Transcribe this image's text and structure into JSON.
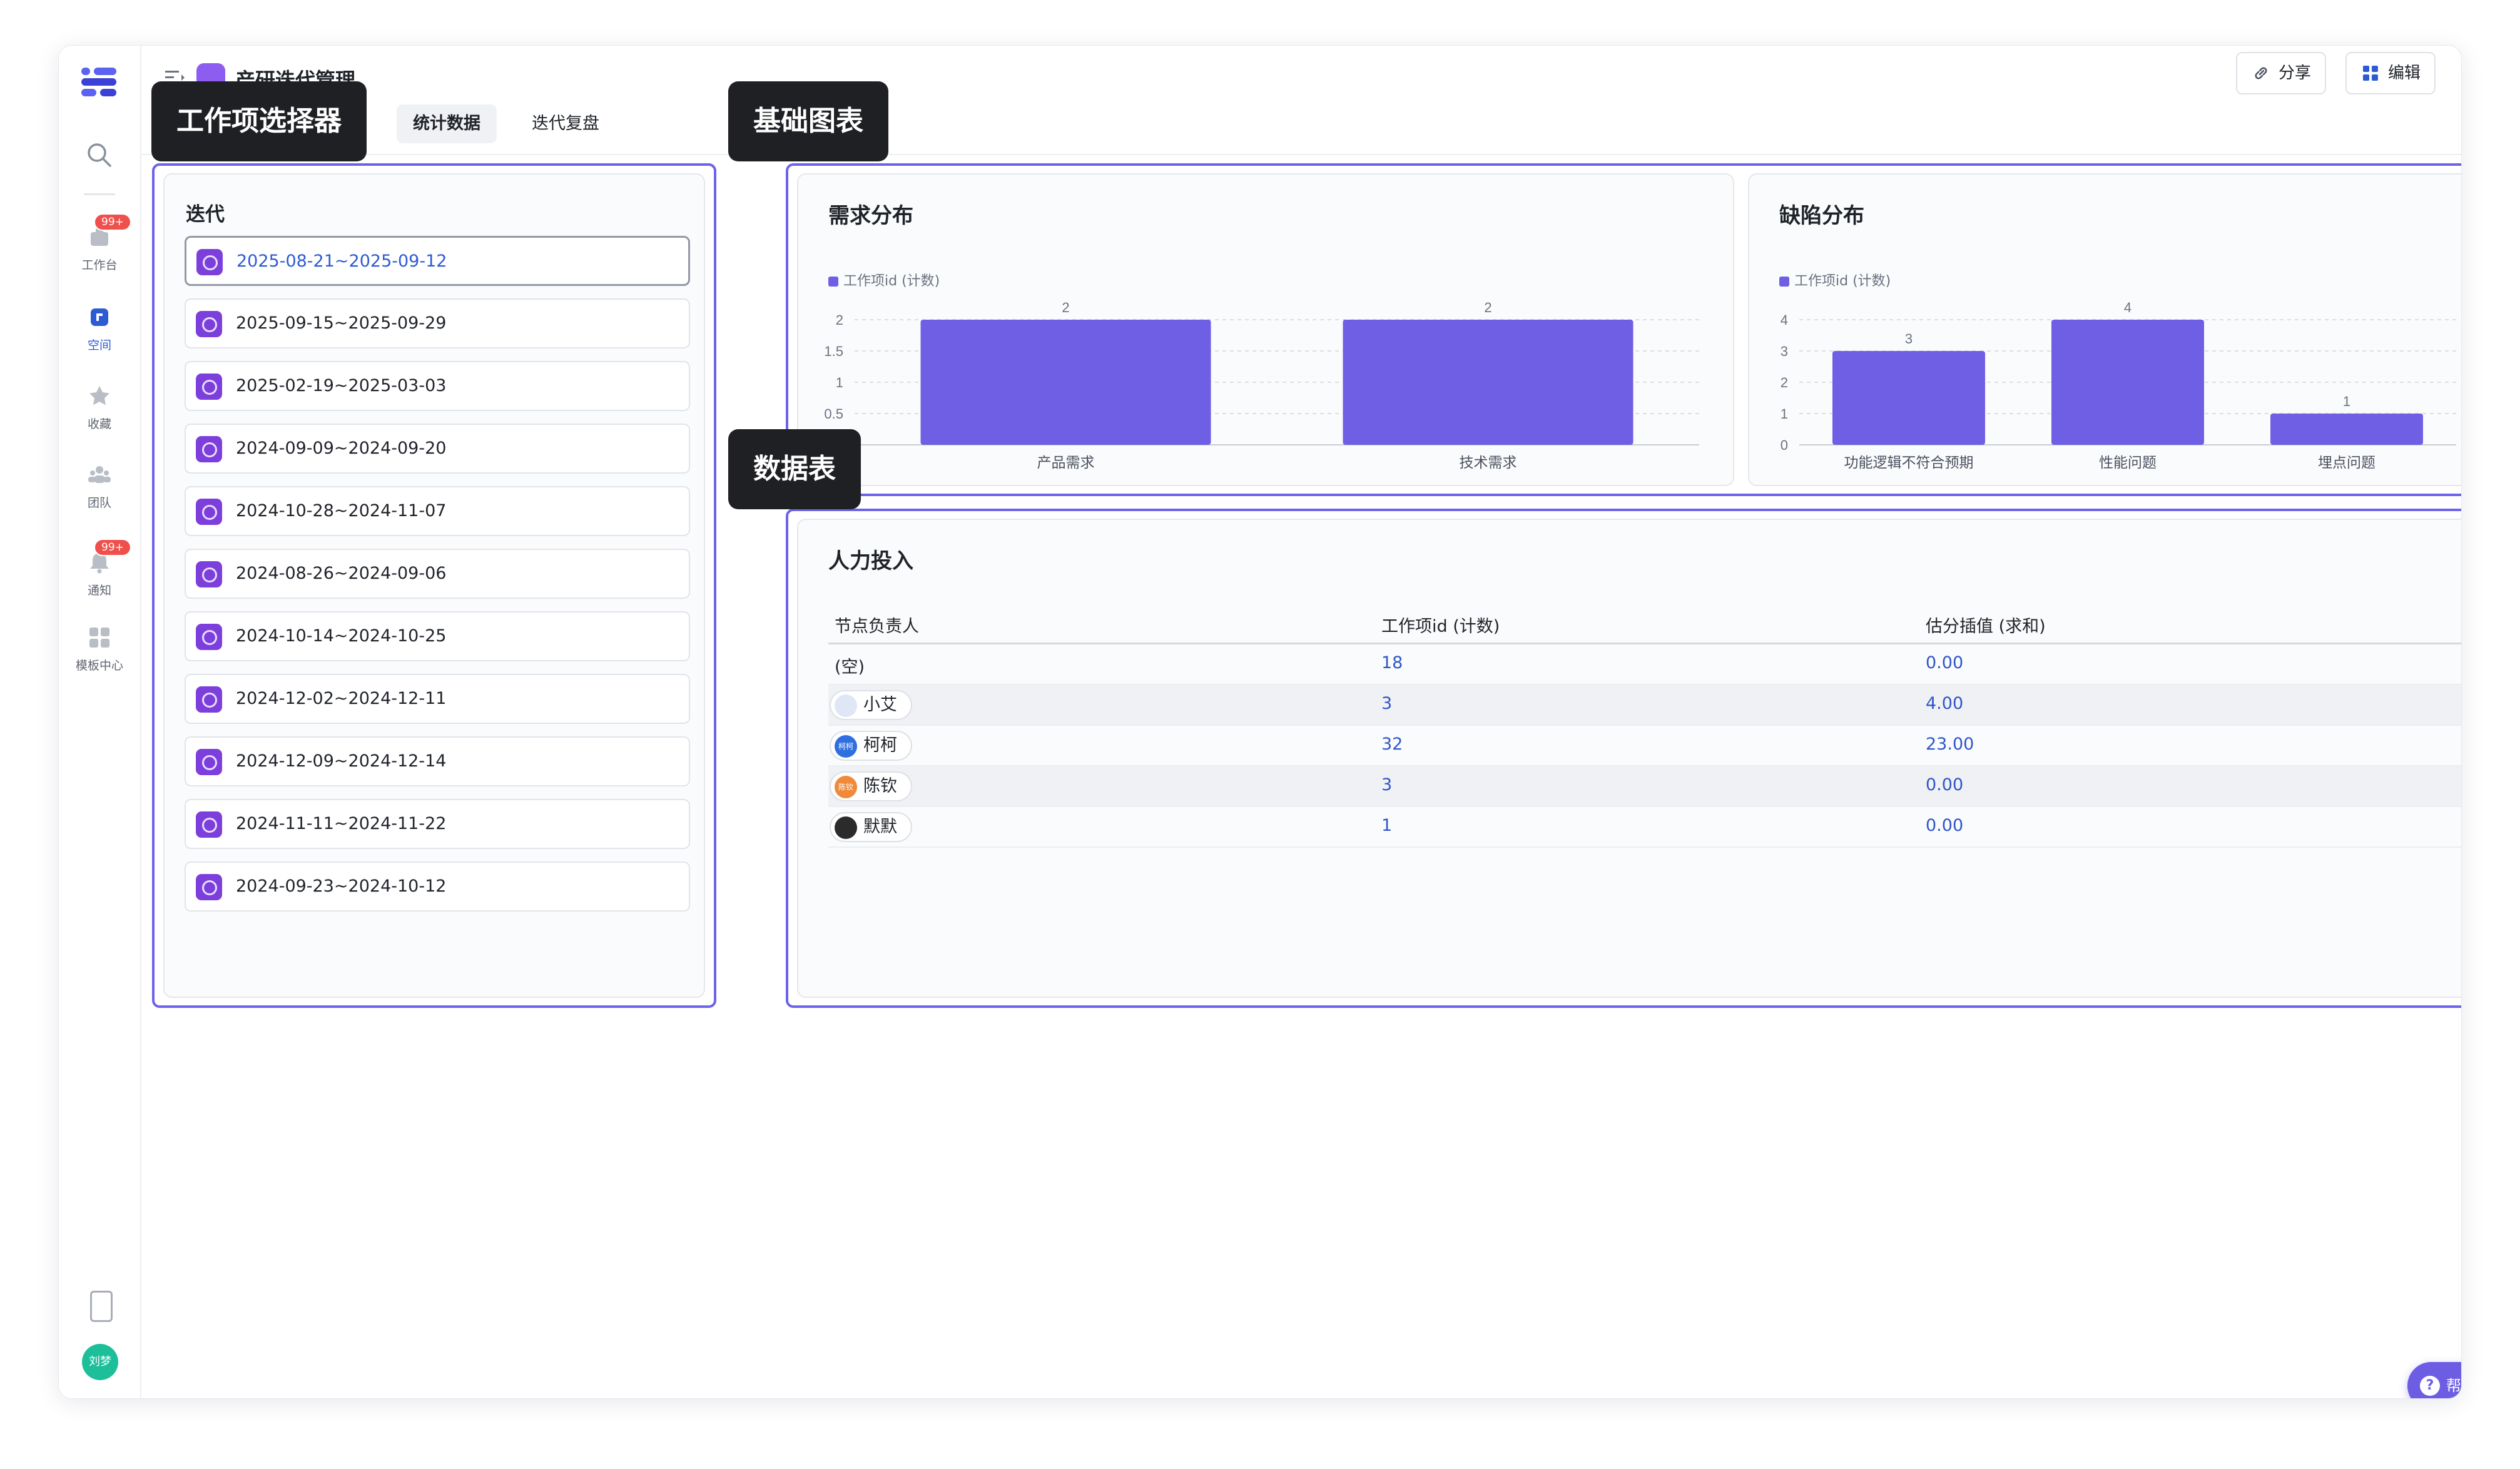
{
  "header": {
    "title": "产研迭代管理",
    "share_label": "分享",
    "edit_label": "编辑",
    "tabs": [
      {
        "label": "统计数据",
        "active": true
      },
      {
        "label": "迭代复盘",
        "active": false
      }
    ]
  },
  "sidebar": {
    "items": [
      {
        "label": "工作台",
        "badge": "99+",
        "icon": "home-icon"
      },
      {
        "label": "空间",
        "icon": "space-icon",
        "active": true
      },
      {
        "label": "收藏",
        "icon": "star-icon"
      },
      {
        "label": "团队",
        "icon": "team-icon"
      },
      {
        "label": "通知",
        "badge": "99+",
        "icon": "bell-icon"
      },
      {
        "label": "模板中心",
        "icon": "template-icon"
      }
    ],
    "user_avatar": "刘梦"
  },
  "callouts": {
    "selector": "工作项选择器",
    "chart": "基础图表",
    "table": "数据表"
  },
  "iteration_panel": {
    "label": "迭代",
    "items": [
      "2025-08-21~2025-09-12",
      "2025-09-15~2025-09-29",
      "2025-02-19~2025-03-03",
      "2024-09-09~2024-09-20",
      "2024-10-28~2024-11-07",
      "2024-08-26~2024-09-06",
      "2024-10-14~2024-10-25",
      "2024-12-02~2024-12-11",
      "2024-12-09~2024-12-14",
      "2024-11-11~2024-11-22",
      "2024-09-23~2024-10-12"
    ],
    "selected_index": 0
  },
  "colors": {
    "accent": "#6c63ea",
    "bar": "#6e5fe5",
    "link": "#2f56c8"
  },
  "chart_data": [
    {
      "type": "bar",
      "title": "需求分布",
      "legend": "工作项id (计数)",
      "categories": [
        "产品需求",
        "技术需求"
      ],
      "values": [
        2,
        2
      ],
      "yticks": [
        0.5,
        1,
        1.5,
        2
      ],
      "ylim": [
        0,
        2
      ]
    },
    {
      "type": "bar",
      "title": "缺陷分布",
      "legend": "工作项id (计数)",
      "categories": [
        "功能逻辑不符合预期",
        "性能问题",
        "埋点问题"
      ],
      "values": [
        3,
        4,
        1
      ],
      "yticks": [
        0,
        1,
        2,
        3,
        4
      ],
      "ylim": [
        0,
        4
      ]
    }
  ],
  "table": {
    "title": "人力投入",
    "columns": [
      "节点负责人",
      "工作项id (计数)",
      "估分插值 (求和)"
    ],
    "rows": [
      {
        "owner": "(空)",
        "count": "18",
        "sum": "0.00",
        "avatar": null
      },
      {
        "owner": "小艾",
        "count": "3",
        "sum": "4.00",
        "avatar": {
          "text": "",
          "color": "#dfe7f7"
        }
      },
      {
        "owner": "柯柯",
        "count": "32",
        "sum": "23.00",
        "avatar": {
          "text": "柯柯",
          "color": "#2f6fe0"
        }
      },
      {
        "owner": "陈钦",
        "count": "3",
        "sum": "0.00",
        "avatar": {
          "text": "陈钦",
          "color": "#f0893a"
        }
      },
      {
        "owner": "默默",
        "count": "1",
        "sum": "0.00",
        "avatar": {
          "text": "",
          "color": "#2b2b2b"
        }
      }
    ]
  },
  "help_label": "帮助"
}
